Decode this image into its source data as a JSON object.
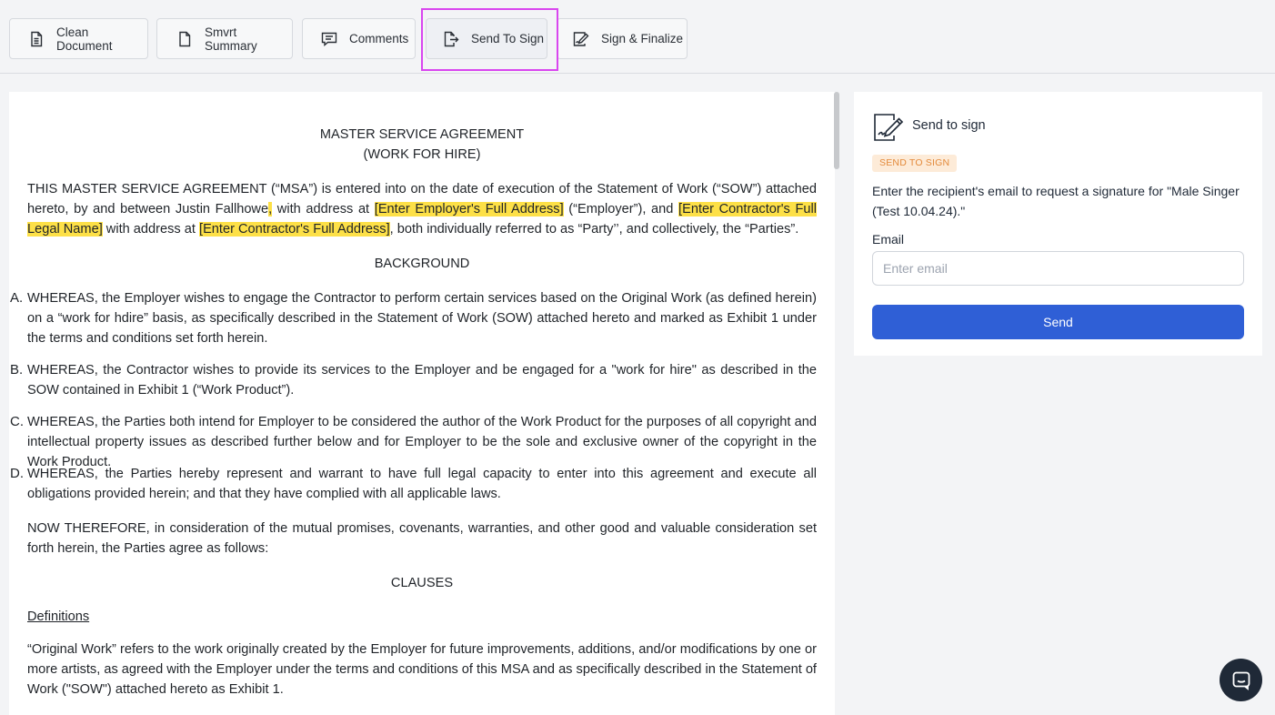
{
  "toolbar": {
    "clean_document": "Clean Document",
    "smart_summary": "Smvrt Summary",
    "comments": "Comments",
    "send_to_sign": "Send To Sign",
    "sign_finalize": "Sign & Finalize"
  },
  "document": {
    "title_line1": "MASTER SERVICE AGREEMENT",
    "title_line2": "(WORK FOR HIRE)",
    "intro": {
      "p1": "THIS MASTER SERVICE AGREEMENT (“MSA”) is entered into on the date of execution of the Statement of Work (“SOW”) attached hereto, by and between Justin Fallhowe",
      "p1_comma": ",",
      "p2": " with address at ",
      "employer_address": "[Enter Employer's Full Address]",
      "p3": " (“Employer”), and ",
      "contractor_name": "[Enter Contractor's Full Legal Name]",
      "p4": " with address at ",
      "contractor_address": "[Enter Contractor's Full Address]",
      "p5": ", both individually referred to as “Party’’, and collectively, the “Parties”."
    },
    "background_heading": "BACKGROUND",
    "whereas": [
      {
        "letter": "A.",
        "text": "WHEREAS, the Employer wishes to engage the Contractor to perform certain services based on the Original Work (as defined herein) on a “work for hdire” basis, as specifically described in the Statement of Work (SOW) attached hereto and marked as Exhibit 1 under the terms and conditions set forth herein."
      },
      {
        "letter": "B.",
        "text": "WHEREAS, the Contractor wishes to provide its services to the Employer and be engaged for a \"work for hire\" as described in the SOW contained in Exhibit 1 (“Work Product”)."
      },
      {
        "letter": "C.",
        "text": "WHEREAS, the Parties both intend for Employer to be considered the author of the Work Product for the purposes of all copyright and intellectual property issues as described further below and for Employer to be the sole and exclusive owner of the copyright in the Work Product."
      },
      {
        "letter": "D.",
        "text": "WHEREAS, the Parties hereby represent and warrant to have full legal capacity to enter into this agreement and execute all obligations provided herein; and that they have complied with all applicable laws."
      }
    ],
    "now_therefore": "NOW THEREFORE, in consideration of the mutual promises, covenants, warranties, and other good and valuable consideration set forth herein, the Parties agree as follows:",
    "clauses_heading": "CLAUSES",
    "definitions_heading": "Definitions",
    "original_work": "“Original Work” refers to the work originally created by the Employer for future improvements, additions, and/or modifications by one or more artists, as agreed with the Employer under the terms and conditions of this MSA and as specifically described in the Statement of Work (\"SOW\") attached hereto as Exhibit 1."
  },
  "panel": {
    "title": "Send to sign",
    "badge": "SEND TO SIGN",
    "description": "Enter the recipient's email to request a signature for \"Male Singer (Test 10.04.24).\"",
    "email_label": "Email",
    "email_placeholder": "Enter email",
    "email_value": "",
    "send_label": "Send"
  },
  "icons": {
    "clean_document": "document-icon",
    "smart_summary": "file-icon",
    "comments": "comment-icon",
    "send_to_sign": "send-document-icon",
    "sign_finalize": "signature-icon",
    "panel": "signature-icon",
    "chat": "chat-icon"
  },
  "colors": {
    "accent": "#2f5fd6",
    "highlight": "#fde047",
    "selection_frame": "#d946ef",
    "badge_bg": "#fdebd8",
    "badge_text": "#e38a3b"
  }
}
